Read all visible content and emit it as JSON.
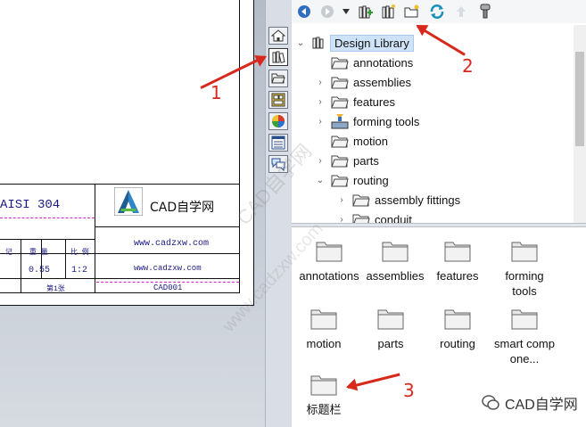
{
  "drawing": {
    "material": "AISI 304",
    "logo_text": "CAD自学网",
    "website_1": "www.cadzxw.com",
    "website_2": "www.cadzxw.com",
    "drawing_number": "CAD001",
    "scale_value": "1:2",
    "weight_value": "0.55",
    "header_ji": "记",
    "header_zhong": "重 量",
    "header_bili": "比 例",
    "sheet_info": "第1张"
  },
  "toolbar": {
    "icons": [
      "back-icon",
      "forward-icon",
      "dropdown-icon",
      "add-library-icon",
      "design-library-icon",
      "new-folder-icon",
      "refresh-icon",
      "up-icon",
      "options-icon"
    ]
  },
  "tree": {
    "root": "Design Library",
    "items": [
      {
        "label": "annotations"
      },
      {
        "label": "assemblies"
      },
      {
        "label": "features"
      },
      {
        "label": "forming tools"
      },
      {
        "label": "motion"
      },
      {
        "label": "parts"
      },
      {
        "label": "routing"
      },
      {
        "label": "assembly fittings"
      },
      {
        "label": "conduit"
      }
    ]
  },
  "folders": [
    {
      "label": "annotations"
    },
    {
      "label": "assemblies"
    },
    {
      "label": "features"
    },
    {
      "label": "forming tools"
    },
    {
      "label": "motion"
    },
    {
      "label": "parts"
    },
    {
      "label": "routing"
    },
    {
      "label": "smart compone..."
    },
    {
      "label": "标题栏"
    }
  ],
  "annotations": {
    "n1": "1",
    "n2": "2",
    "n3": "3"
  },
  "watermark": {
    "text": "CAD自学网",
    "diag_1": "CAD自学网",
    "diag_2": "www.cadzxw.com"
  },
  "colors": {
    "accent": "#d8281c",
    "selection": "#cfe3f8",
    "folder": "#e4e4e4"
  }
}
